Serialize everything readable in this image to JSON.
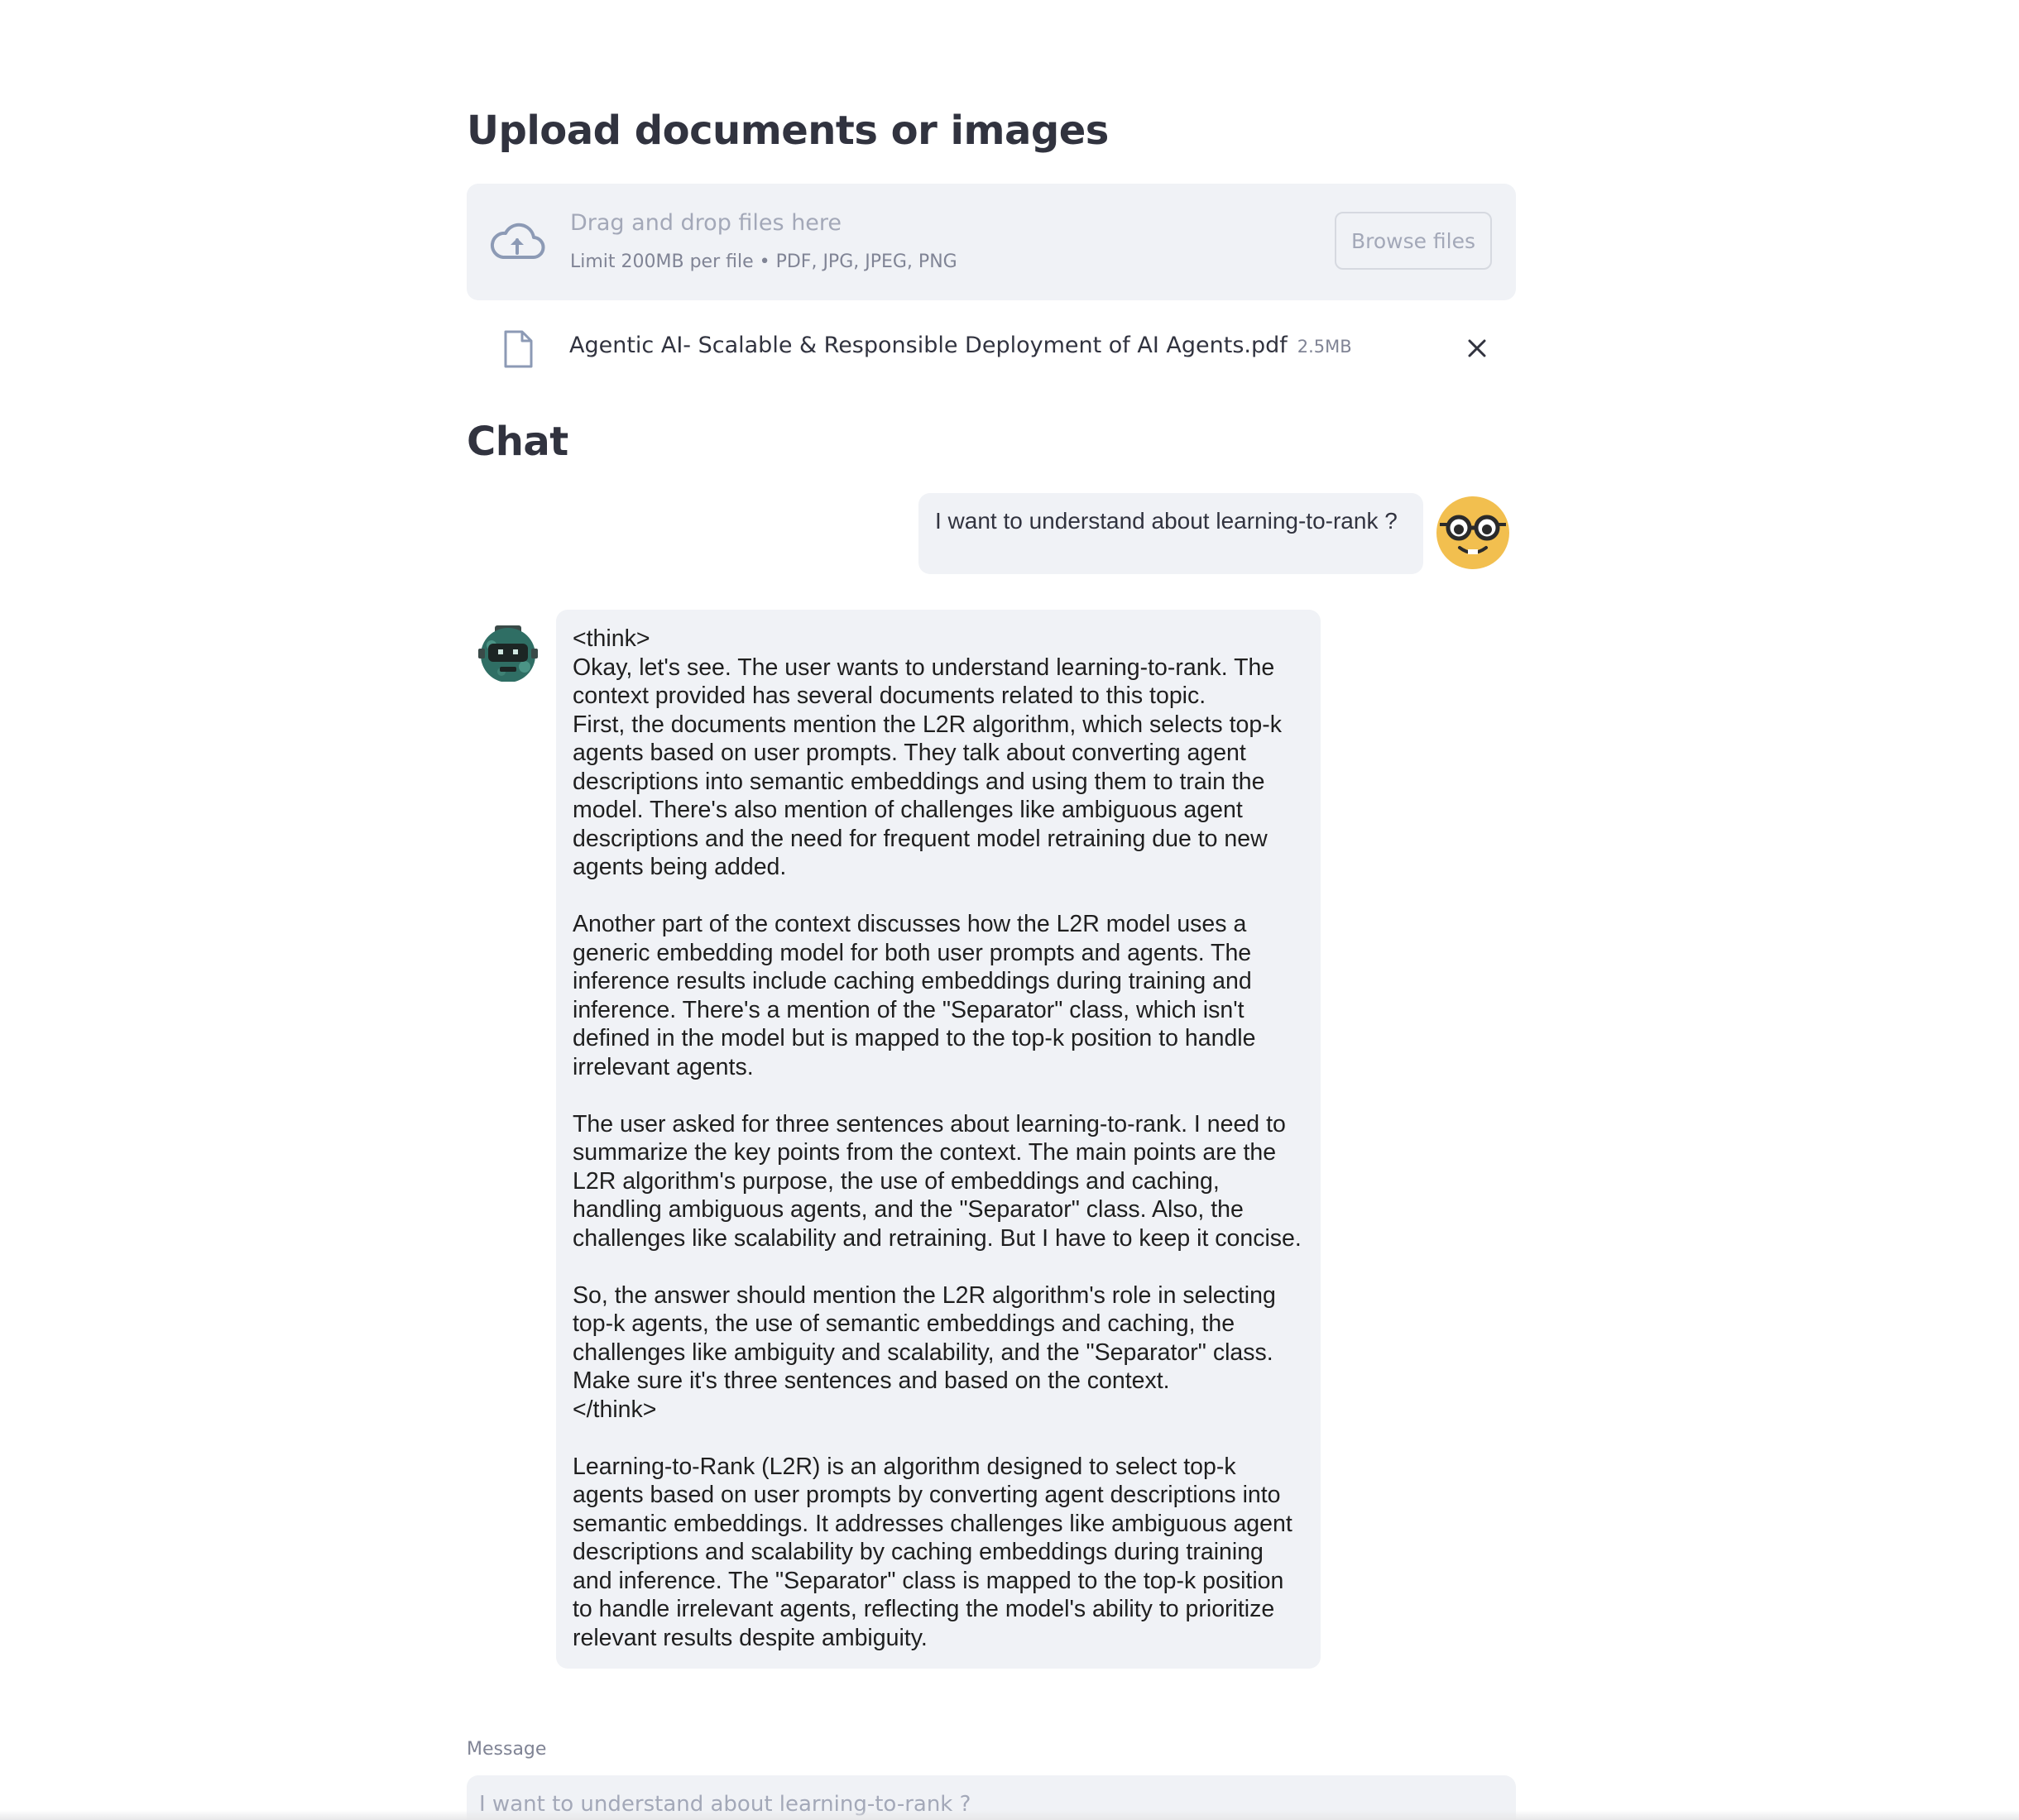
{
  "upload": {
    "heading": "Upload documents or images",
    "drop_title": "Drag and drop files here",
    "drop_limit": "Limit 200MB per file • PDF, JPG, JPEG, PNG",
    "browse_label": "Browse files",
    "icon": "cloud-upload-icon"
  },
  "file": {
    "name": "Agentic AI- Scalable & Responsible Deployment of AI Agents.pdf",
    "size": "2.5MB",
    "icon": "file-icon",
    "remove_icon": "close-icon"
  },
  "chat": {
    "heading": "Chat",
    "messages": [
      {
        "role": "user",
        "avatar": "nerd-face-avatar",
        "text": "I want to understand about learning-to-rank ?"
      },
      {
        "role": "assistant",
        "avatar": "robot-avatar",
        "text": "<think>\nOkay, let's see. The user wants to understand learning-to-rank. The context provided has several documents related to this topic.\nFirst, the documents mention the L2R algorithm, which selects top-k agents based on user prompts. They talk about converting agent descriptions into semantic embeddings and using them to train the model. There's also mention of challenges like ambiguous agent descriptions and the need for frequent model retraining due to new agents being added.\n\nAnother part of the context discusses how the L2R model uses a generic embedding model for both user prompts and agents. The inference results include caching embeddings during training and inference. There's a mention of the \"Separator\" class, which isn't defined in the model but is mapped to the top-k position to handle irrelevant agents.\n\nThe user asked for three sentences about learning-to-rank. I need to summarize the key points from the context. The main points are the L2R algorithm's purpose, the use of embeddings and caching, handling ambiguous agents, and the \"Separator\" class. Also, the challenges like scalability and retraining. But I have to keep it concise.\n\nSo, the answer should mention the L2R algorithm's role in selecting top-k agents, the use of semantic embeddings and caching, the challenges like ambiguity and scalability, and the \"Separator\" class. Make sure it's three sentences and based on the context.\n</think>\n\nLearning-to-Rank (L2R) is an algorithm designed to select top-k agents based on user prompts by converting agent descriptions into semantic embeddings. It addresses challenges like ambiguous agent descriptions and scalability by caching embeddings during training and inference. The \"Separator\" class is mapped to the top-k position to handle irrelevant agents, reflecting the model's ability to prioritize relevant results despite ambiguity."
      }
    ]
  },
  "input": {
    "label": "Message",
    "placeholder": "I want to understand about learning-to-rank ?"
  },
  "colors": {
    "panel_bg": "#f0f2f6",
    "text": "#31333f",
    "muted": "#a3a8b8",
    "user_avatar": "#f2bf4f",
    "bot_avatar": "#2f6e64"
  }
}
